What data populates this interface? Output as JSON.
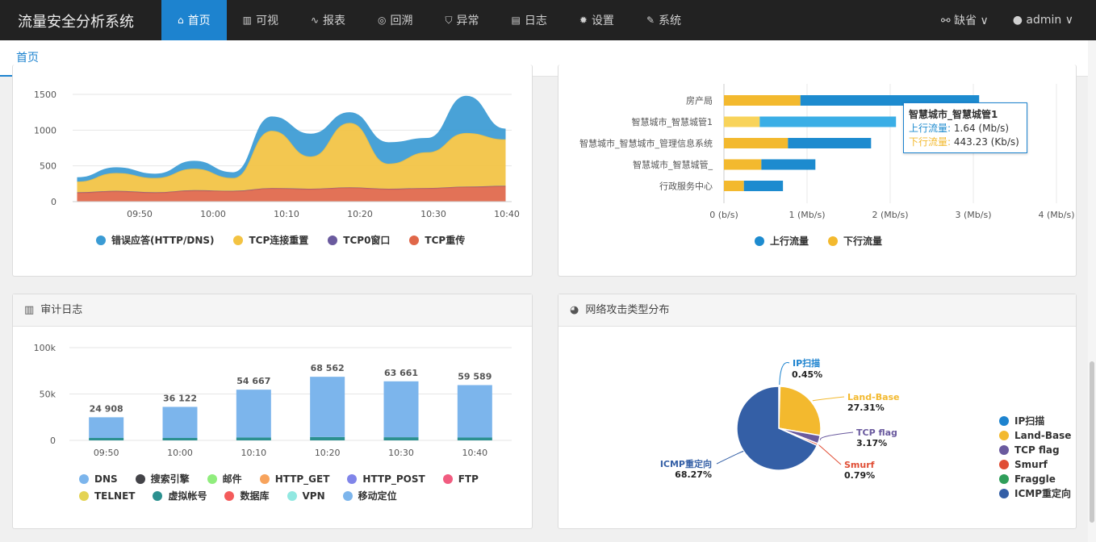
{
  "app": {
    "title": "流量安全分析系统"
  },
  "nav": {
    "items": [
      {
        "label": "首页",
        "icon": "home-icon",
        "glyph": "⌂"
      },
      {
        "label": "可视",
        "icon": "bar-chart-icon",
        "glyph": "▥"
      },
      {
        "label": "报表",
        "icon": "line-chart-icon",
        "glyph": "∿"
      },
      {
        "label": "回溯",
        "icon": "target-icon",
        "glyph": "◎"
      },
      {
        "label": "异常",
        "icon": "shield-icon",
        "glyph": "⛉"
      },
      {
        "label": "日志",
        "icon": "file-icon",
        "glyph": "▤"
      },
      {
        "label": "设置",
        "icon": "gear-icon",
        "glyph": "✹"
      },
      {
        "label": "系统",
        "icon": "wrench-icon",
        "glyph": "✎"
      }
    ],
    "right": {
      "profile": "缺省",
      "profile_glyph": "⚯",
      "user": "admin",
      "user_glyph": "●",
      "chevron": "∨"
    }
  },
  "tabs": {
    "home": "首页"
  },
  "colors": {
    "accent": "#1d83cf",
    "error": "#3a9bd4",
    "tcp_reset": "#f3c342",
    "tcp_zero": "#6a5a9e",
    "tcp_retrans": "#e06749"
  },
  "chart_data": [
    {
      "type": "area",
      "x": [
        "09:45",
        "09:50",
        "09:55",
        "10:00",
        "10:05",
        "10:10",
        "10:15",
        "10:20",
        "10:25",
        "10:30",
        "10:35",
        "10:40"
      ],
      "xticks": [
        "09:50",
        "10:00",
        "10:10",
        "10:20",
        "10:30",
        "10:40"
      ],
      "yticks": [
        "1500",
        "1000",
        "500",
        "0"
      ],
      "ylim": [
        0,
        1500
      ],
      "series": [
        {
          "name": "错误应答(HTTP/DNS)",
          "color": "#3a9bd4",
          "values": [
            60,
            80,
            60,
            110,
            80,
            200,
            320,
            150,
            300,
            200,
            520,
            150
          ]
        },
        {
          "name": "TCP连接重置",
          "color": "#f3c342",
          "values": [
            150,
            250,
            200,
            300,
            180,
            800,
            450,
            900,
            350,
            500,
            750,
            650
          ]
        },
        {
          "name": "TCP0窗口",
          "color": "#6a5a9e",
          "values": [
            5,
            5,
            5,
            5,
            5,
            5,
            5,
            5,
            5,
            5,
            5,
            5
          ]
        },
        {
          "name": "TCP重传",
          "color": "#e06749",
          "values": [
            120,
            140,
            120,
            150,
            140,
            180,
            170,
            190,
            170,
            180,
            200,
            210
          ]
        }
      ]
    },
    {
      "type": "bar",
      "orientation": "horizontal",
      "categories": [
        "房产局",
        "智慧城市_智慧城管1",
        "智慧城市_智慧城市_管理信息系统",
        "智慧城市_智慧城管_",
        "行政服务中心"
      ],
      "xticks": [
        "0 (b/s)",
        "1 (Mb/s)",
        "2 (Mb/s)",
        "3 (Mb/s)",
        "4 (Mb/s)"
      ],
      "xlim": [
        0,
        4
      ],
      "series": [
        {
          "name": "上行流量",
          "color": "#1d8bcf",
          "values": [
            2.15,
            1.64,
            1.0,
            0.65,
            0.47
          ]
        },
        {
          "name": "下行流量",
          "color": "#f3b92e",
          "values": [
            0.92,
            0.43,
            0.77,
            0.45,
            0.24
          ]
        }
      ]
    },
    {
      "type": "bar",
      "title": "审计日志",
      "categories": [
        "09:50",
        "10:00",
        "10:10",
        "10:20",
        "10:30",
        "10:40"
      ],
      "totals": [
        "24 908",
        "36 122",
        "54 667",
        "68 562",
        "63 661",
        "59 589"
      ],
      "yticks": [
        "100k",
        "50k",
        "0"
      ],
      "ylim": [
        0,
        100000
      ],
      "series": [
        {
          "name": "DNS",
          "color": "#7cb5ec",
          "values": [
            22500,
            32500,
            49000,
            62000,
            57500,
            54000
          ]
        },
        {
          "name": "虚拟帐号",
          "color": "#2b908f",
          "values": [
            2408,
            3622,
            5667,
            6562,
            6161,
            5589
          ]
        }
      ],
      "legend": [
        {
          "name": "DNS",
          "color": "#7cb5ec"
        },
        {
          "name": "搜索引擎",
          "color": "#434348"
        },
        {
          "name": "邮件",
          "color": "#90ed7d"
        },
        {
          "name": "HTTP_GET",
          "color": "#f7a35c"
        },
        {
          "name": "HTTP_POST",
          "color": "#8085e9"
        },
        {
          "name": "FTP",
          "color": "#f15c80"
        },
        {
          "name": "TELNET",
          "color": "#e4d354"
        },
        {
          "name": "虚拟帐号",
          "color": "#2b908f"
        },
        {
          "name": "数据库",
          "color": "#f45b5b"
        },
        {
          "name": "VPN",
          "color": "#91e8e1"
        },
        {
          "name": "移动定位",
          "color": "#7cb5ec"
        }
      ]
    },
    {
      "type": "pie",
      "title": "网络攻击类型分布",
      "slices": [
        {
          "name": "IP扫描",
          "value": 0.45,
          "label": "0.45%",
          "color": "#1d83cf"
        },
        {
          "name": "Land-Base",
          "value": 27.31,
          "label": "27.31%",
          "color": "#f3b92e"
        },
        {
          "name": "TCP flag",
          "value": 3.17,
          "label": "3.17%",
          "color": "#6a5a9e"
        },
        {
          "name": "Smurf",
          "value": 0.79,
          "label": "0.79%",
          "color": "#e04d34"
        },
        {
          "name": "Fraggle",
          "value": 0,
          "label": "",
          "color": "#2f9e5a"
        },
        {
          "name": "ICMP重定向",
          "value": 68.27,
          "label": "68.27%",
          "color": "#345fa6"
        }
      ]
    }
  ],
  "audit_panel": {
    "title": "审计日志",
    "icon": "bar-chart-icon"
  },
  "attack_panel": {
    "title": "网络攻击类型分布",
    "icon": "pie-chart-icon"
  },
  "tooltip": {
    "title": "智慧城市_智慧城管1",
    "up_label": "上行流量:",
    "up_value": "1.64 (Mb/s)",
    "down_label": "下行流量:",
    "down_value": "443.23 (Kb/s)"
  }
}
